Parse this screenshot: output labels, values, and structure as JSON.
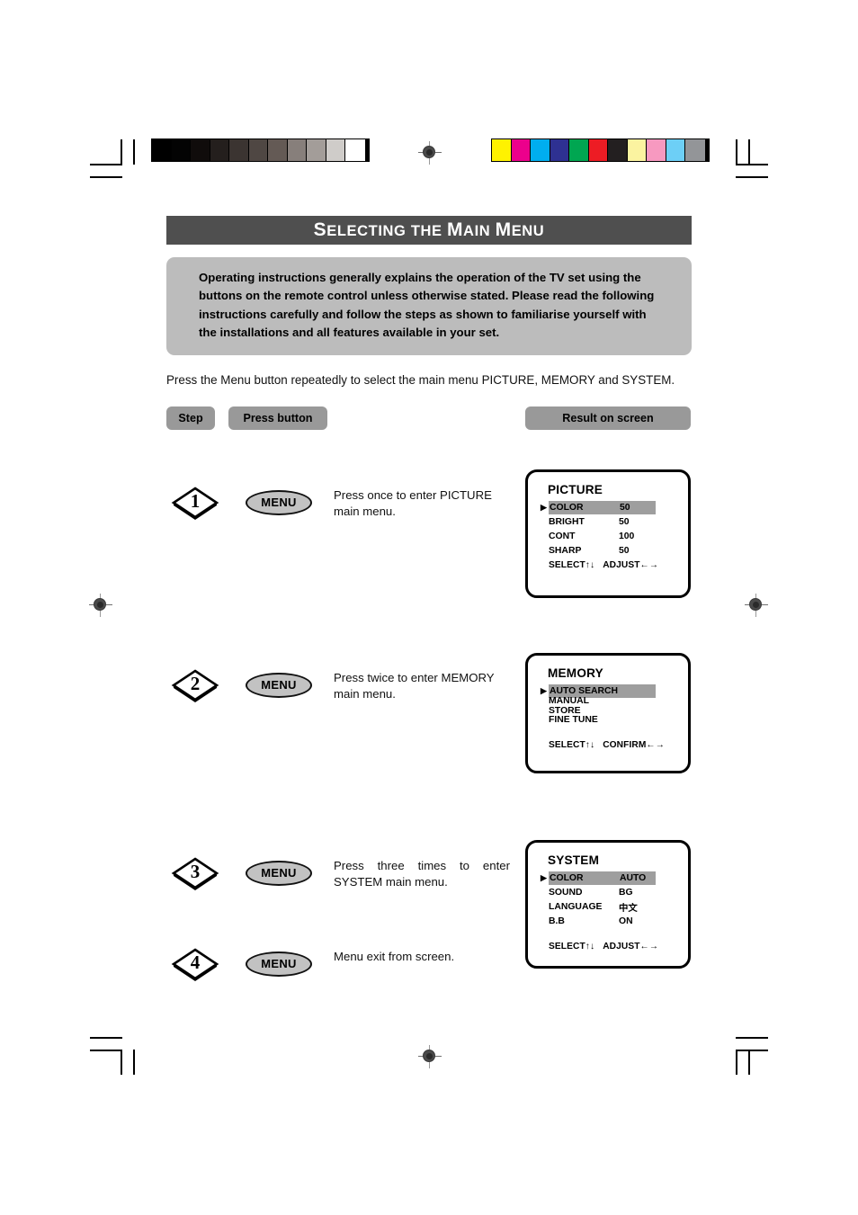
{
  "document": {
    "title": {
      "part1_cap": "S",
      "part1_rest": "ELECTING",
      "part2": "THE",
      "part3_cap": "M",
      "part3_rest": "AIN",
      "part4_cap": "M",
      "part4_rest": "ENU",
      "full_text": "SELECTING THE MAIN MENU"
    },
    "intro_paragraph": "Operating instructions generally explains the operation of the TV set using the buttons on the remote control unless otherwise stated. Please read the following instructions carefully and follow the steps as shown to familiarise yourself with the installations and all features available in your set.",
    "lead_line": "Press the Menu button repeatedly to select the main menu PICTURE, MEMORY and SYSTEM."
  },
  "column_headers": {
    "step": "Step",
    "press_button": "Press button",
    "result_on_screen": "Result on screen"
  },
  "steps": [
    {
      "number": "1",
      "button": "MENU",
      "description": "Press once to enter PICTURE main menu."
    },
    {
      "number": "2",
      "button": "MENU",
      "description": "Press twice to enter MEMORY main menu."
    },
    {
      "number": "3",
      "button": "MENU",
      "description": "Press three times to enter SYSTEM main menu."
    },
    {
      "number": "4",
      "button": "MENU",
      "description": "Menu exit from screen."
    }
  ],
  "screens": {
    "picture": {
      "title": "PICTURE",
      "rows": [
        {
          "label": "COLOR",
          "value": "50",
          "selected": true
        },
        {
          "label": "BRIGHT",
          "value": "50",
          "selected": false
        },
        {
          "label": "CONT",
          "value": "100",
          "selected": false
        },
        {
          "label": "SHARP",
          "value": "50",
          "selected": false
        }
      ],
      "footer_left": "SELECT↑↓",
      "footer_right": "ADJUST←→"
    },
    "memory": {
      "title": "MEMORY",
      "rows": [
        {
          "label": "AUTO  SEARCH",
          "value": "",
          "selected": true
        },
        {
          "label": "MANUAL STORE",
          "value": "",
          "selected": false
        },
        {
          "label": "FINE TUNE",
          "value": "",
          "selected": false
        }
      ],
      "footer_left": "SELECT↑↓",
      "footer_right": "CONFIRM←→"
    },
    "system": {
      "title": "SYSTEM",
      "rows": [
        {
          "label": "COLOR",
          "value": "AUTO",
          "selected": true
        },
        {
          "label": "SOUND",
          "value": "BG",
          "selected": false
        },
        {
          "label": "LANGUAGE",
          "value": "中文",
          "selected": false
        },
        {
          "label": "B.B",
          "value": "ON",
          "selected": false
        }
      ],
      "footer_left": "SELECT↑↓",
      "footer_right": "ADJUST←→"
    }
  },
  "print_marks": {
    "grayscale_swatches": [
      "#000000",
      "#030303",
      "#100c0b",
      "#241f1d",
      "#3b3431",
      "#4f4743",
      "#645a55",
      "#877f7b",
      "#a39d99",
      "#cfccc9",
      "#ffffff"
    ],
    "color_swatches": [
      "#fff200",
      "#ec008c",
      "#00aeef",
      "#2e3192",
      "#00a651",
      "#ed1c24",
      "#231f20",
      "#fbf3a0",
      "#f799c0",
      "#6dcff6",
      "#939598"
    ],
    "selection_highlight": "#9e9e9e",
    "title_bar_color": "#4f4f4f",
    "pill_color": "#999999",
    "intro_box_color": "#bcbcbc"
  }
}
